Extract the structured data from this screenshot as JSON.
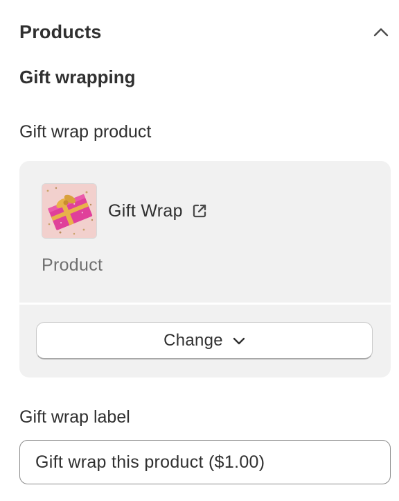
{
  "section": {
    "title": "Products"
  },
  "gift_wrapping": {
    "title": "Gift wrapping",
    "product_label": "Gift wrap product",
    "product": {
      "name": "Gift Wrap",
      "type": "Product",
      "thumbnail_icon": "gift-box-image"
    },
    "change_button_label": "Change",
    "gift_label_field_label": "Gift wrap label",
    "gift_label_value": "Gift wrap this product ($1.00)"
  },
  "icons": {
    "collapse": "chevron-up-icon",
    "external": "external-link-icon",
    "dropdown": "chevron-down-icon"
  },
  "colors": {
    "card_background": "#f1f1f1",
    "text_primary": "#303030",
    "text_secondary": "#6f6f6f",
    "gift_box": "#e0409a",
    "ribbon": "#e8b24a"
  }
}
